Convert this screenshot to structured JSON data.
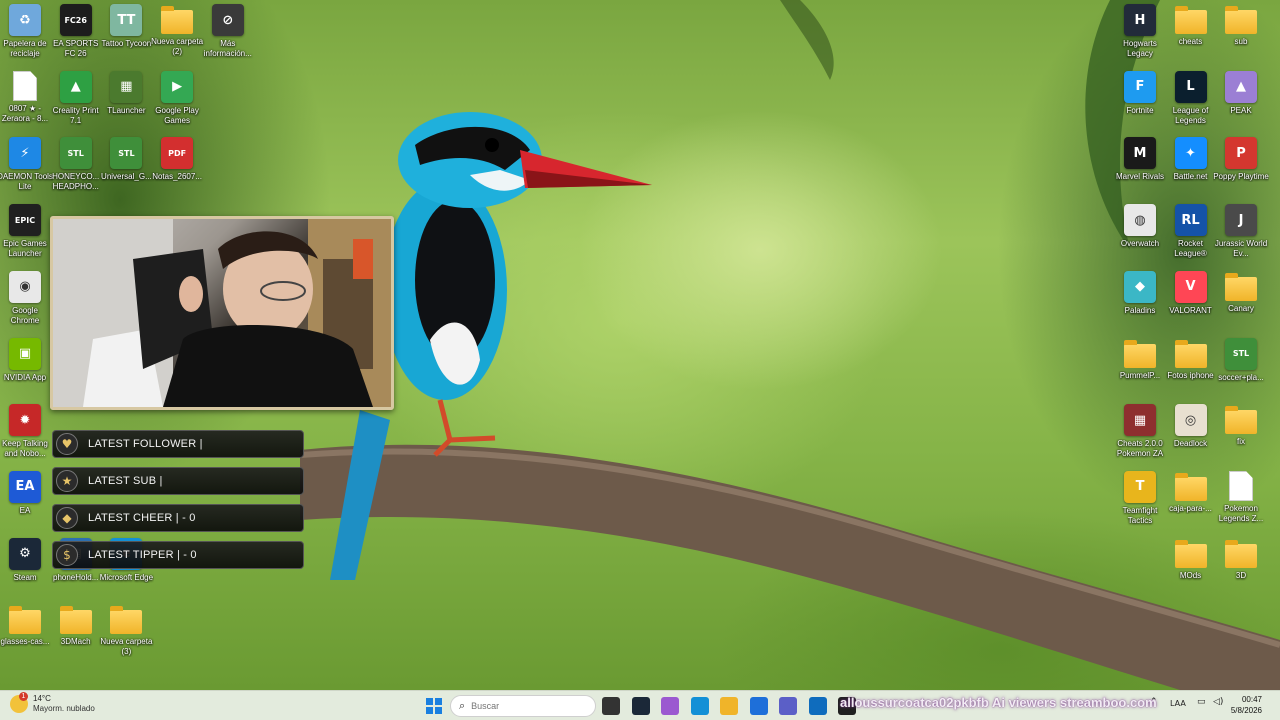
{
  "desktop_icons": [
    {
      "id": "recycle",
      "label": "Papelera de reciclaje",
      "color": "#6fa8dc",
      "glyph": "♻"
    },
    {
      "id": "fc26",
      "label": "EA SPORTS FC 26",
      "color": "#1d1d1d",
      "glyph": "FC26"
    },
    {
      "id": "tattoo",
      "label": "Tattoo Tycoon",
      "color": "#7fb7a0",
      "glyph": "TT"
    },
    {
      "id": "nueva2",
      "label": "Nueva carpeta (2)",
      "color": "folder",
      "glyph": ""
    },
    {
      "id": "mas",
      "label": "Más información...",
      "color": "#3a3a3a",
      "glyph": "⊘"
    },
    {
      "id": "zeraora",
      "label": "0807 ★ - Zeraora - 8...",
      "color": "doc",
      "glyph": ""
    },
    {
      "id": "creality",
      "label": "Creality Print 7.1",
      "color": "#2ea043",
      "glyph": "▲"
    },
    {
      "id": "tlauncher",
      "label": "TLauncher",
      "color": "#4b7a2e",
      "glyph": "▦"
    },
    {
      "id": "gplay",
      "label": "Google Play Games",
      "color": "#34a853",
      "glyph": "▶"
    },
    {
      "id": "daemon",
      "label": "DAEMON Tools Lite",
      "color": "#1e88e5",
      "glyph": "⚡"
    },
    {
      "id": "honeyco",
      "label": "HONEYCO... HEADPHO...",
      "color": "#3f8f3a",
      "glyph": "STL"
    },
    {
      "id": "universal",
      "label": "Universal_G...",
      "color": "#3f8f3a",
      "glyph": "STL"
    },
    {
      "id": "notas",
      "label": "Notas_2607...",
      "color": "#d32f2f",
      "glyph": "PDF"
    },
    {
      "id": "epic",
      "label": "Epic Games Launcher",
      "color": "#202020",
      "glyph": "EPIC"
    },
    {
      "id": "chrome",
      "label": "Google Chrome",
      "color": "#e8e8e8",
      "glyph": "◉"
    },
    {
      "id": "nvidia",
      "label": "NVIDIA App",
      "color": "#76b900",
      "glyph": "▣"
    },
    {
      "id": "keeptalking",
      "label": "Keep Talking and Nobo...",
      "color": "#c62828",
      "glyph": "✹"
    },
    {
      "id": "ea",
      "label": "EA",
      "color": "#1e5ad6",
      "glyph": "EA"
    },
    {
      "id": "steam",
      "label": "Steam",
      "color": "#1b2838",
      "glyph": "⚙"
    },
    {
      "id": "phonehold",
      "label": "phoneHold...",
      "color": "#2d6fb0",
      "glyph": "▤"
    },
    {
      "id": "edge",
      "label": "Microsoft Edge",
      "color": "#1390d6",
      "glyph": "e"
    },
    {
      "id": "glasses",
      "label": "glasses-cas...",
      "color": "folder",
      "glyph": ""
    },
    {
      "id": "3dmach",
      "label": "3DMach",
      "color": "folder",
      "glyph": ""
    },
    {
      "id": "nueva3",
      "label": "Nueva carpeta (3)",
      "color": "folder",
      "glyph": ""
    },
    {
      "id": "hogwarts",
      "label": "Hogwarts Legacy",
      "color": "#222b3a",
      "glyph": "H"
    },
    {
      "id": "cheats",
      "label": "cheats",
      "color": "folder",
      "glyph": ""
    },
    {
      "id": "sub",
      "label": "sub",
      "color": "folder",
      "glyph": ""
    },
    {
      "id": "fortnite",
      "label": "Fortnite",
      "color": "#1e9bf0",
      "glyph": "F"
    },
    {
      "id": "lol",
      "label": "League of Legends",
      "color": "#0b1f2e",
      "glyph": "L"
    },
    {
      "id": "peak",
      "label": "PEAK",
      "color": "#9b7fd4",
      "glyph": "▲"
    },
    {
      "id": "marvel",
      "label": "Marvel Rivals",
      "color": "#1a1a1a",
      "glyph": "M"
    },
    {
      "id": "battlenet",
      "label": "Battle.net",
      "color": "#148eff",
      "glyph": "✦"
    },
    {
      "id": "poppy",
      "label": "Poppy Playtime",
      "color": "#d4372f",
      "glyph": "P"
    },
    {
      "id": "overwatch",
      "label": "Overwatch",
      "color": "#e8e8e8",
      "glyph": "◍"
    },
    {
      "id": "rocket",
      "label": "Rocket League®",
      "color": "#1553a8",
      "glyph": "RL"
    },
    {
      "id": "jurassic",
      "label": "Jurassic World Ev...",
      "color": "#4a4a4a",
      "glyph": "J"
    },
    {
      "id": "paladins",
      "label": "Paladins",
      "color": "#3bb7c6",
      "glyph": "◆"
    },
    {
      "id": "valorant",
      "label": "VALORANT",
      "color": "#ff4655",
      "glyph": "V"
    },
    {
      "id": "canary",
      "label": "Canary",
      "color": "folder",
      "glyph": ""
    },
    {
      "id": "pumme",
      "label": "PummelP...",
      "color": "folder",
      "glyph": ""
    },
    {
      "id": "fotosiphone",
      "label": "Fotos iphone",
      "color": "folder",
      "glyph": ""
    },
    {
      "id": "soccer",
      "label": "soccer+pla...",
      "color": "#3f8f3a",
      "glyph": "STL"
    },
    {
      "id": "cheats20",
      "label": "Cheats 2.0.0 Pokemon ZA",
      "color": "#8e2f2f",
      "glyph": "▦"
    },
    {
      "id": "deadlock",
      "label": "Deadlock",
      "color": "#e8e0d0",
      "glyph": "◎"
    },
    {
      "id": "fix",
      "label": "fix",
      "color": "folder",
      "glyph": ""
    },
    {
      "id": "tft",
      "label": "Teamfight Tactics",
      "color": "#e8b51c",
      "glyph": "T"
    },
    {
      "id": "caja",
      "label": "caja-para-...",
      "color": "folder",
      "glyph": ""
    },
    {
      "id": "pokemonza",
      "label": "Pokemon Legends Z...",
      "color": "doc",
      "glyph": ""
    },
    {
      "id": "mods",
      "label": "MOds",
      "color": "folder",
      "glyph": ""
    },
    {
      "id": "3d",
      "label": "3D",
      "color": "folder",
      "glyph": ""
    }
  ],
  "alerts": [
    {
      "label": "LATEST FOLLOWER |",
      "glyph": "♥"
    },
    {
      "label": "LATEST SUB |",
      "glyph": "★"
    },
    {
      "label": "LATEST CHEER |  - 0",
      "glyph": "◆"
    },
    {
      "label": "LATEST TIPPER |  - 0",
      "glyph": "$"
    }
  ],
  "taskbar": {
    "weather_temp": "14°C",
    "weather_desc": "Mayorm. nublado",
    "weather_alert_count": "1",
    "search_placeholder": "Buscar",
    "stream_text": "alloussurcoatca02pkbfb  Ai viewers streamboo.com",
    "language": "LAA",
    "time": "00:47",
    "date": "5/8/2026"
  },
  "taskbar_apps": [
    {
      "name": "task-view-icon",
      "color": "#333333"
    },
    {
      "name": "steam-taskbar-icon",
      "color": "#1b2838"
    },
    {
      "name": "copilot-taskbar-icon",
      "color": "#9b59d0"
    },
    {
      "name": "edge-taskbar-icon",
      "color": "#1390d6"
    },
    {
      "name": "explorer-taskbar-icon",
      "color": "#f0b429"
    },
    {
      "name": "store-taskbar-icon",
      "color": "#1e6fd9"
    },
    {
      "name": "teams-taskbar-icon",
      "color": "#5b5fc7"
    },
    {
      "name": "outlook-taskbar-icon",
      "color": "#0f6cbd"
    },
    {
      "name": "obs-taskbar-icon",
      "color": "#202020"
    }
  ]
}
